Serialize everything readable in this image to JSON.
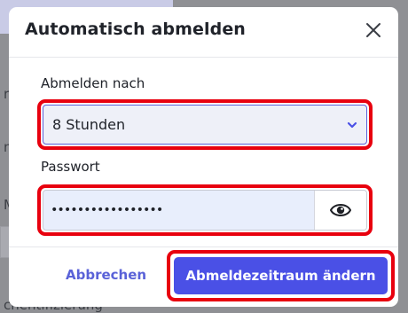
{
  "background": {
    "fragments": [
      "r",
      "n",
      "Mi",
      "chentifizierung"
    ]
  },
  "dialog": {
    "title": "Automatisch abmelden",
    "logout_label": "Abmelden nach",
    "logout_value": "8 Stunden",
    "password_label": "Passwort",
    "password_value": "•••••••••••••••••",
    "cancel_label": "Abbrechen",
    "confirm_label": "Abmeldezeitraum ändern"
  },
  "icons": {
    "close": "close-icon",
    "chevron": "chevron-down-icon",
    "eye": "eye-icon"
  },
  "colors": {
    "primary": "#4a50e6",
    "link": "#5a62d8",
    "highlight": "#e8000e"
  }
}
